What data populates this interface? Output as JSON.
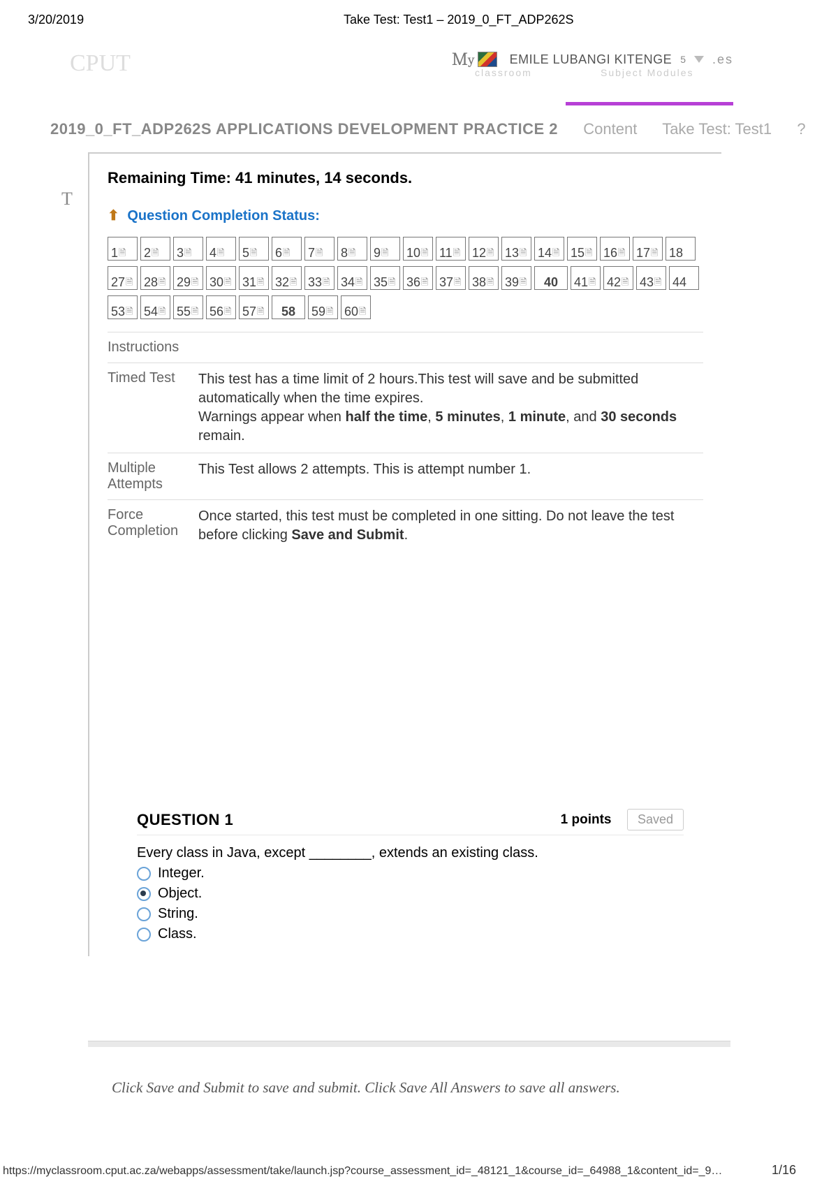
{
  "print": {
    "date": "3/20/2019",
    "title": "Take Test: Test1 – 2019_0_FT_ADP262S"
  },
  "header": {
    "my_prefix": "M",
    "my_sub": "y",
    "user": "EMILE LUBANGI KITENGE",
    "faded1": "classroom",
    "faded2": "Subject Modules",
    "count": "5",
    "es": ".es"
  },
  "logo": "CPUT",
  "breadcrumb": {
    "course": "2019_0_FT_ADP262S APPLICATIONS DEVELOPMENT PRACTICE 2",
    "content": "Content",
    "take": "Take Test: Test1",
    "help": "?"
  },
  "timer": {
    "label": "Remaining Time:",
    "minutes": "41",
    "min_lab": "minutes,",
    "seconds": "14",
    "sec_lab": "seconds."
  },
  "qcs": "Question Completion Status:",
  "nav": {
    "total": 60,
    "row1": [
      1,
      2,
      3,
      4,
      5,
      6,
      7,
      8,
      9,
      10,
      11,
      12,
      13,
      14,
      15,
      16,
      17,
      18
    ],
    "row2": [
      27,
      28,
      29,
      30,
      31,
      32,
      33,
      34,
      35,
      36,
      37,
      38,
      39,
      40,
      41,
      42,
      43,
      44
    ],
    "row3": [
      53,
      54,
      55,
      56,
      57,
      58,
      59,
      60
    ],
    "current": [
      40,
      58
    ],
    "no_icon": [
      18,
      40,
      44,
      58
    ]
  },
  "instructions": {
    "head": "Instructions",
    "rows": [
      {
        "k": "Timed Test",
        "v": "This test has a time limit of 2 hours.This test will save and be submitted automatically when the time expires.<br>Warnings appear when <b>half the time</b>, <b>5 minutes</b>, <b>1 minute</b>, and <b>30 seconds</b> remain."
      },
      {
        "k": "Multiple Attempts",
        "v": "This Test allows 2 attempts. This is attempt number 1."
      },
      {
        "k": "Force Completion",
        "v": "Once started, this test must be completed in one sitting. Do not leave the test before clicking <b>Save and Submit</b>."
      }
    ]
  },
  "question": {
    "title": "QUESTION 1",
    "points": "1 points",
    "saved": "Saved",
    "text": "Every class in Java, except ________, extends an existing class.",
    "options": [
      "Integer.",
      "Object.",
      "String.",
      "Class."
    ],
    "selected": 1
  },
  "footer_msg": "Click Save and Submit to save and submit. Click Save All Answers to save all answers.",
  "url": "https://myclassroom.cput.ac.za/webapps/assessment/take/launch.jsp?course_assessment_id=_48121_1&course_id=_64988_1&content_id=_9…",
  "pageno": "1/16",
  "loader": "T"
}
